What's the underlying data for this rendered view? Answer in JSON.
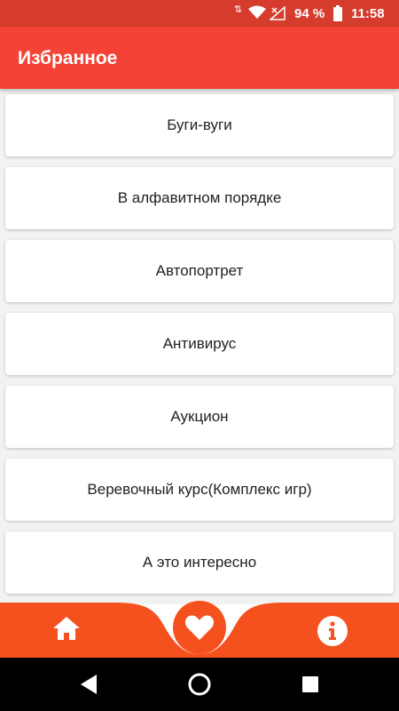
{
  "status": {
    "battery": "94 %",
    "time": "11:58"
  },
  "app_bar": {
    "title": "Избранное"
  },
  "favorites": [
    "Буги-вуги",
    "В алфавитном порядке",
    "Автопортрет",
    "Антивирус",
    "Аукцион",
    "Веревочный курс(Комплекс игр)",
    "А это интересно"
  ],
  "bottom_nav": {
    "items": [
      "home-icon",
      "heart-icon",
      "info-icon"
    ],
    "active": "heart-icon",
    "accent": "#f4511e"
  },
  "colors": {
    "status_bar": "#d63c2d",
    "app_bar": "#f44336",
    "nav_bar": "#f4511e"
  }
}
